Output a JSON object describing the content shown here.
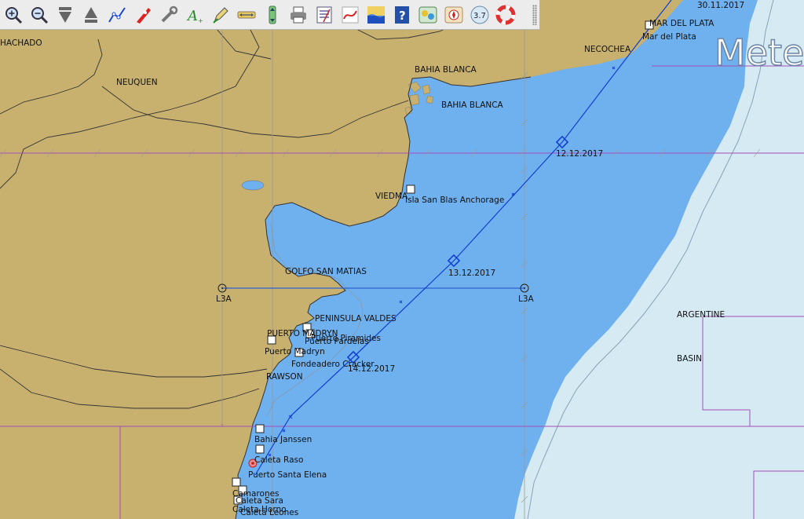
{
  "toolbar": {
    "buttons": [
      {
        "name": "zoom-in-icon"
      },
      {
        "name": "zoom-out-icon"
      },
      {
        "name": "scale-down-icon"
      },
      {
        "name": "scale-up-icon"
      },
      {
        "name": "route-icon"
      },
      {
        "name": "boat-follow-icon"
      },
      {
        "name": "settings-wrench-icon"
      },
      {
        "name": "text-icon"
      },
      {
        "name": "pen-icon"
      },
      {
        "name": "ruler-icon"
      },
      {
        "name": "vertical-arrows-icon"
      },
      {
        "name": "print-icon"
      },
      {
        "name": "route-manager-icon"
      },
      {
        "name": "track-icon"
      },
      {
        "name": "tide-icon"
      },
      {
        "name": "help-icon"
      },
      {
        "name": "aislayer-icon"
      },
      {
        "name": "compass-icon"
      },
      {
        "name": "version-badge-icon"
      },
      {
        "name": "lifebuoy-icon"
      }
    ],
    "badge_text": "3.7"
  },
  "labels": {
    "chachado": "HACHADO",
    "neuquen": "NEUQUEN",
    "bahia_blanca_1": "BAHIA BLANCA",
    "bahia_blanca_2": "BAHIA BLANCA",
    "necochea": "NECOCHEA",
    "mar_del_plata_upper": "MAR DEL PLATA",
    "mar_del_plata": "Mar del Plata",
    "date_top": "30.11.2017",
    "meteo": "Mete",
    "viedma": "VIEDMA",
    "isla_san_blas": "Isla San Blas Anchorage",
    "golfo_san_matias": "GOLFO SAN MATIAS",
    "l3a_left": "L3A",
    "l3a_right": "L3A",
    "peninsula_valdes": "PENINSULA VALDES",
    "puerto_madryn_upper": "PUERTO MADRYN",
    "puerto_piramides": "Puerto Piramides",
    "puerto_pardelas": "Puerto Pardelas",
    "puerto_madryn": "Puerto Madryn",
    "fondeadero": "Fondeadero Cracker",
    "rawson": "RAWSON",
    "argentine": "ARGENTINE",
    "basin": "BASIN",
    "bahia_janssen": "Bahia Janssen",
    "caleta_raso": "Caleta Raso",
    "puerto_santa_elena": "Puerto Santa Elena",
    "camarones": "Camarones",
    "caleta_sara": "Caleta Sara",
    "caleta_horno": "Caleta Horno",
    "caleta_leones": "Caleta Leones"
  },
  "route": {
    "wp_dates": [
      "12.12.2017",
      "13.12.2017",
      "14.12.2017"
    ]
  },
  "colors": {
    "land": "#c8b06e",
    "shallow": "#6fb0ee",
    "deep": "#d5eaf2",
    "route": "#1040d0",
    "grid": "#9a4fb0"
  }
}
